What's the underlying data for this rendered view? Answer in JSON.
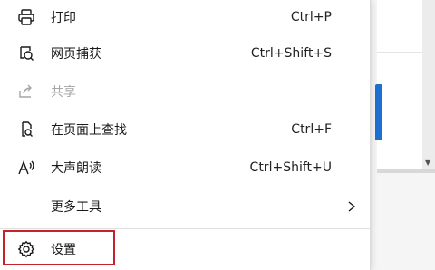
{
  "menu": {
    "items": [
      {
        "label": "打印",
        "shortcut": "Ctrl+P",
        "icon": "printer-icon",
        "disabled": false
      },
      {
        "label": "网页捕获",
        "shortcut": "Ctrl+Shift+S",
        "icon": "web-capture-icon",
        "disabled": false
      },
      {
        "label": "共享",
        "shortcut": "",
        "icon": "share-icon",
        "disabled": true
      },
      {
        "label": "在页面上查找",
        "shortcut": "Ctrl+F",
        "icon": "find-on-page-icon",
        "disabled": false
      },
      {
        "label": "大声朗读",
        "shortcut": "Ctrl+Shift+U",
        "icon": "read-aloud-icon",
        "disabled": false
      },
      {
        "label": "更多工具",
        "shortcut": "",
        "icon": "chevron-right-icon",
        "disabled": false
      },
      {
        "label": "设置",
        "shortcut": "",
        "icon": "gear-icon",
        "disabled": false
      }
    ],
    "highlight_color": "#c4232b",
    "disabled_color": "#a6a6a6",
    "accent_color": "#1f6fd1"
  }
}
